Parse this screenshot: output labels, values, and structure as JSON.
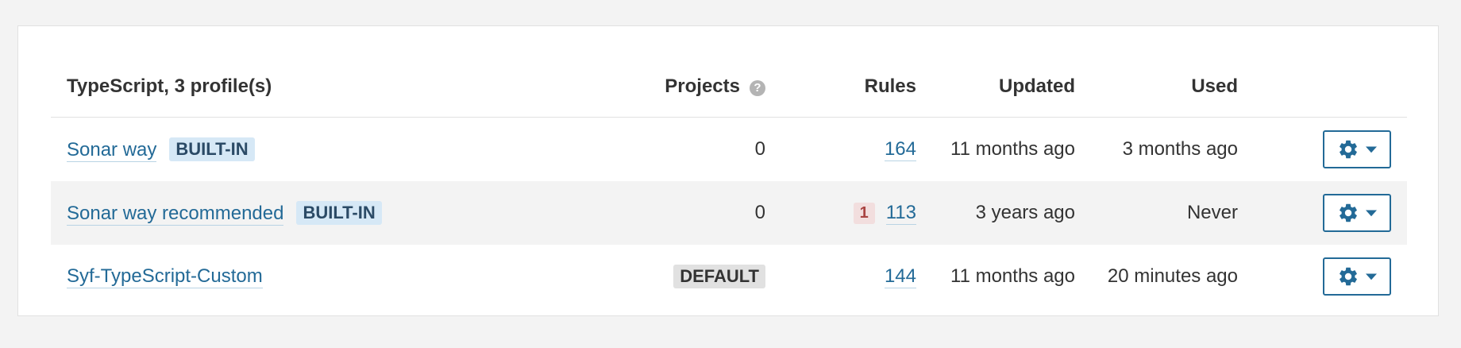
{
  "header": {
    "profiles_title": "TypeScript, 3 profile(s)",
    "projects": "Projects",
    "rules": "Rules",
    "updated": "Updated",
    "used": "Used",
    "help_glyph": "?"
  },
  "rows": [
    {
      "name": "Sonar way",
      "builtin_badge": "BUILT-IN",
      "projects": "0",
      "default_badge": "",
      "deprecated_count": "",
      "rules": "164",
      "updated": "11 months ago",
      "used": "3 months ago"
    },
    {
      "name": "Sonar way recommended",
      "builtin_badge": "BUILT-IN",
      "projects": "0",
      "default_badge": "",
      "deprecated_count": "1",
      "rules": "113",
      "updated": "3 years ago",
      "used": "Never"
    },
    {
      "name": "Syf-TypeScript-Custom",
      "builtin_badge": "",
      "projects": "",
      "default_badge": "DEFAULT",
      "deprecated_count": "",
      "rules": "144",
      "updated": "11 months ago",
      "used": "20 minutes ago"
    }
  ],
  "icons": {
    "help": "help-icon",
    "actions": "gear-icon",
    "dropdown": "caret-down-icon"
  },
  "colors": {
    "link": "#236a97",
    "builtin_badge_bg": "#d6e8f6",
    "default_badge_bg": "#e1e1e1",
    "deprecated_badge_bg": "#f2dede",
    "deprecated_badge_text": "#a94442",
    "striped_row_bg": "#f3f3f3"
  }
}
